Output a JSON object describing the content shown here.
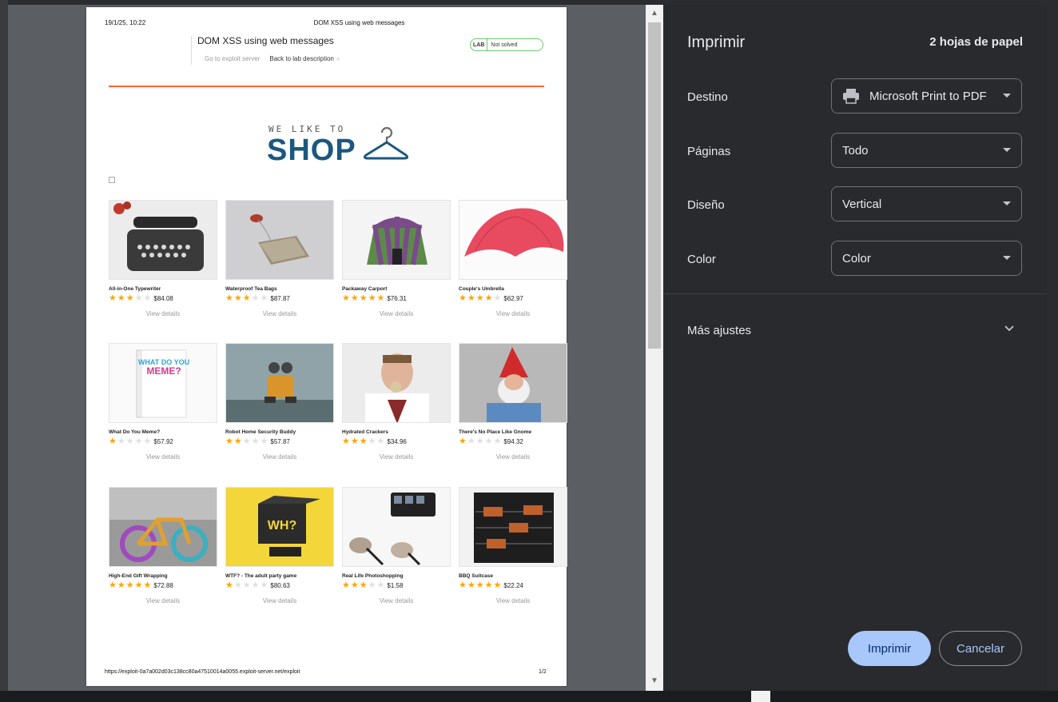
{
  "paper": {
    "header_date": "19/1/25, 10:22",
    "header_title": "DOM XSS using web messages",
    "lab_title": "DOM XSS using web messages",
    "link_exploit": "Go to exploit server",
    "link_back": "Back to lab description",
    "badge_tag": "LAB",
    "badge_status": "Not solved",
    "logo_small": "WE LIKE TO",
    "logo_big": "SHOP",
    "footer_url": "https://exploit-0a7a002d03c138cc80a47510014a0055.exploit-server.net/exploit",
    "footer_page": "1/2",
    "details_label": "View details",
    "products": [
      {
        "name": "All-in-One Typewriter",
        "stars": 3,
        "price": "$84.08",
        "thumb": "typewriter"
      },
      {
        "name": "Waterproof Tea Bags",
        "stars": 3,
        "price": "$87.87",
        "thumb": "teabag"
      },
      {
        "name": "Packaway Carport",
        "stars": 5,
        "price": "$76.31",
        "thumb": "tent"
      },
      {
        "name": "Couple's Umbrella",
        "stars": 4,
        "price": "$62.97",
        "thumb": "umbrella"
      },
      {
        "name": "What Do You Meme?",
        "stars": 1,
        "price": "$57.92",
        "thumb": "meme"
      },
      {
        "name": "Robot Home Security Buddy",
        "stars": 2,
        "price": "$57.87",
        "thumb": "robot"
      },
      {
        "name": "Hydrated Crackers",
        "stars": 3,
        "price": "$34.96",
        "thumb": "crackers"
      },
      {
        "name": "There's No Place Like Gnome",
        "stars": 1,
        "price": "$94.32",
        "thumb": "gnome"
      },
      {
        "name": "High-End Gift Wrapping",
        "stars": 5,
        "price": "$72.88",
        "thumb": "bicycle"
      },
      {
        "name": "WTF? - The adult party game",
        "stars": 1,
        "price": "$80.63",
        "thumb": "wtf"
      },
      {
        "name": "Real Life Photoshopping",
        "stars": 3,
        "price": "$1.58",
        "thumb": "makeup"
      },
      {
        "name": "BBQ Suitcase",
        "stars": 5,
        "price": "$22.24",
        "thumb": "bbq"
      }
    ]
  },
  "dialog": {
    "title": "Imprimir",
    "sheets": "2 hojas de papel",
    "destination_label": "Destino",
    "destination_value": "Microsoft Print to PDF",
    "destination_icon": "printer-icon",
    "pages_label": "Páginas",
    "pages_value": "Todo",
    "layout_label": "Diseño",
    "layout_value": "Vertical",
    "color_label": "Color",
    "color_value": "Color",
    "more_settings": "Más ajustes",
    "print_button": "Imprimir",
    "cancel_button": "Cancelar",
    "accent_color": "#a8c7fa"
  }
}
